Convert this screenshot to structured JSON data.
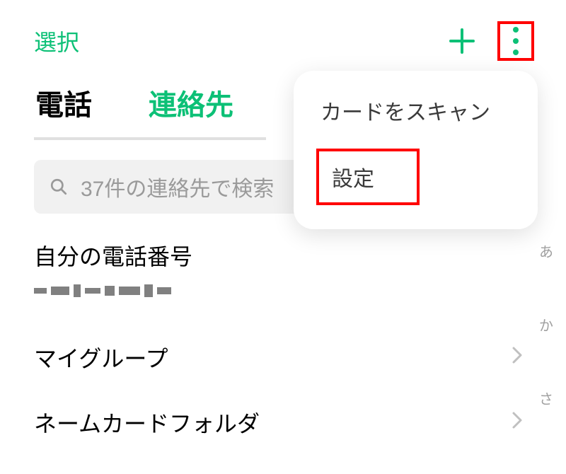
{
  "header": {
    "select_label": "選択"
  },
  "tabs": {
    "phone": "電話",
    "contacts": "連絡先"
  },
  "search": {
    "placeholder": "37件の連絡先で検索"
  },
  "my_number": {
    "title": "自分の電話番号"
  },
  "list": {
    "my_group": "マイグループ",
    "name_card_folder": "ネームカードフォルダ"
  },
  "index": {
    "a": "あ",
    "ka": "か",
    "sa": "さ"
  },
  "menu": {
    "scan_card": "カードをスキャン",
    "settings": "設定"
  }
}
